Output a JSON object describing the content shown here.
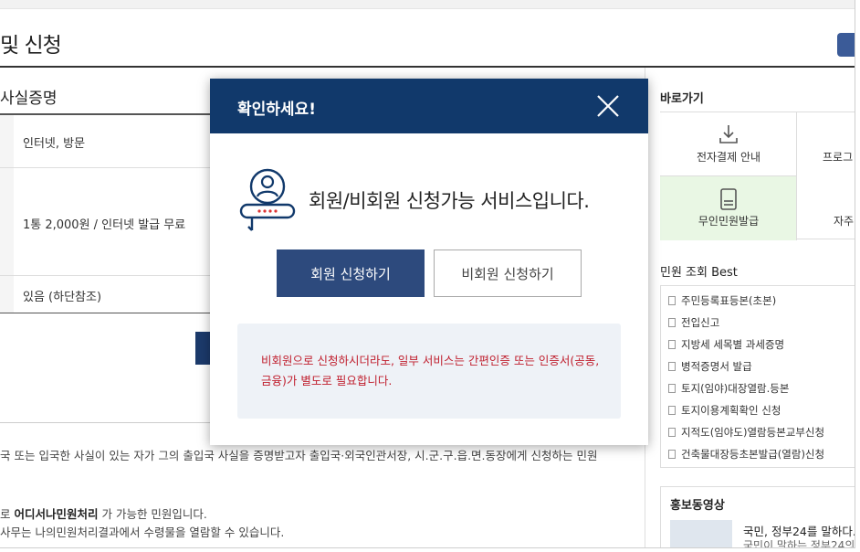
{
  "page": {
    "title": "및 신청",
    "section_title": "사실증명"
  },
  "table": {
    "rows": [
      {
        "value": "인터넷, 방문"
      },
      {
        "value": "1통 2,000원 / 인터넷 발급 무료"
      },
      {
        "value": "있음 (하단참조)"
      }
    ]
  },
  "description": {
    "line1": "국 또는 입국한 사실이 있는 자가 그의 출입국 사실을 증명받고자 출입국·외국인관서장, 시.군.구.읍.면.동장에게 신청하는 민원",
    "line2_prefix": "로 ",
    "line2_bold": "어디서나민원처리",
    "line2_suffix": " 가 가능한 민원입니다.",
    "line3": "사무는 나의민원처리결과에서 수령물을 열람할 수 있습니다."
  },
  "sidebar": {
    "shortcut_title": "바로가기",
    "shortcuts": [
      {
        "label": "전자결제 안내",
        "icon": "download-icon"
      },
      {
        "label": "프로그",
        "icon": ""
      },
      {
        "label": "무인민원발급",
        "icon": "kiosk-icon"
      },
      {
        "label": "자주",
        "icon": ""
      }
    ],
    "best_title": "민원 조회 Best",
    "best_items": [
      "주민등록표등본(초본)",
      "전입신고",
      "지방세 세목별 과세증명",
      "병적증명서 발급",
      "토지(임야)대장열람.등본",
      "토지이용계획확인 신청",
      "지적도(임야도)열람등본교부신청",
      "건축물대장등초본발급(열람)신청"
    ],
    "promo_title": "홍보동영상",
    "promo_headline": "국민, 정부24를 말하다.",
    "promo_sub": "국민이 말하는 정부24의"
  },
  "modal": {
    "title": "확인하세요!",
    "message": "회원/비회원 신청가능 서비스입니다.",
    "member_button": "회원 신청하기",
    "guest_button": "비회원 신청하기",
    "notice": "비회원으로 신청하시더라도, 일부 서비스는 간편인증 또는 인증서(공동, 금융)가 별도로 필요합니다."
  },
  "colors": {
    "modal_header": "#11396b",
    "member_button": "#2d4a7d",
    "notice_text": "#c0202f",
    "notice_bg": "#eef2f7",
    "kiosk_bg": "#e9f7e4"
  }
}
